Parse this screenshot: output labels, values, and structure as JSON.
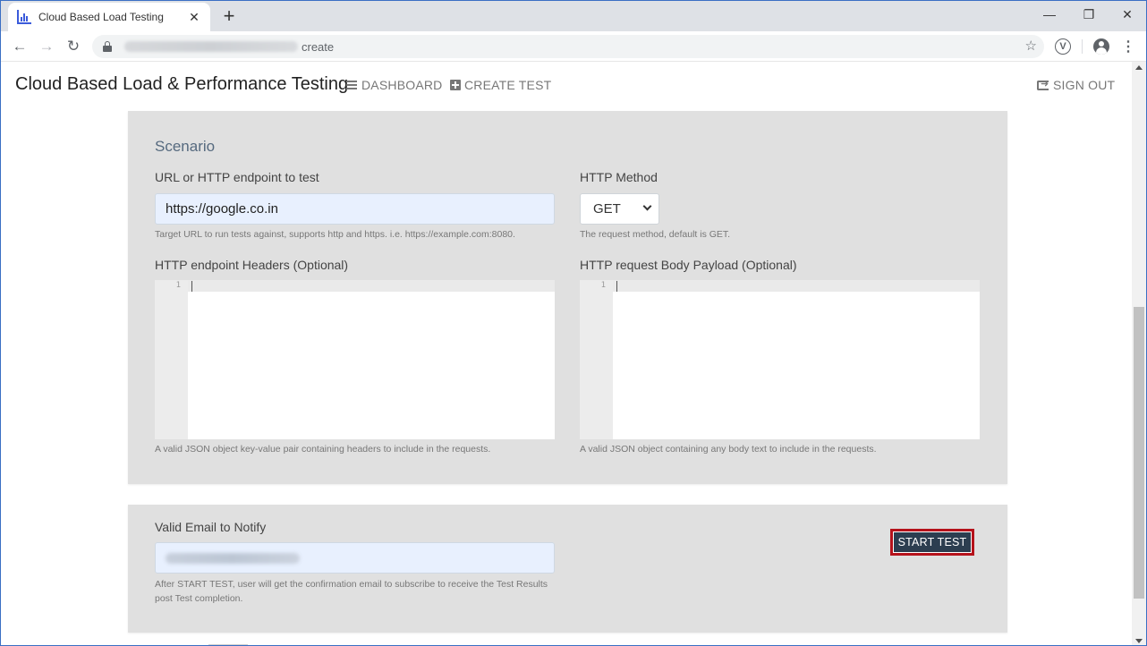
{
  "browser": {
    "tab_title": "Cloud Based Load Testing",
    "tab_close": "✕",
    "new_tab": "+",
    "url_path": "create",
    "window_controls": {
      "minimize": "—",
      "restore": "❐",
      "close": "✕"
    },
    "nav": {
      "back": "←",
      "forward": "→",
      "reload": "↻"
    },
    "bookmark_star": "☆",
    "extension_letter": "V",
    "menu": "⋮"
  },
  "header": {
    "brand": "Cloud Based Load & Performance Testing",
    "dashboard": "DASHBOARD",
    "create_test": "CREATE TEST",
    "sign_out": "SIGN OUT"
  },
  "scenario": {
    "title": "Scenario",
    "url_label": "URL or HTTP endpoint to test",
    "url_value": "https://google.co.in",
    "url_help": "Target URL to run tests against, supports http and https. i.e. https://example.com:8080.",
    "method_label": "HTTP Method",
    "method_value": "GET",
    "method_help": "The request method, default is GET.",
    "headers_label": "HTTP endpoint Headers (Optional)",
    "headers_line": "1",
    "headers_help": "A valid JSON object key-value pair containing headers to include in the requests.",
    "body_label": "HTTP request Body Payload (Optional)",
    "body_line": "1",
    "body_help": "A valid JSON object containing any body text to include in the requests."
  },
  "notify": {
    "email_label": "Valid Email to Notify",
    "email_help": "After START TEST, user will get the confirmation email to subscribe to receive the Test Results post Test completion.",
    "start_button": "START TEST"
  }
}
